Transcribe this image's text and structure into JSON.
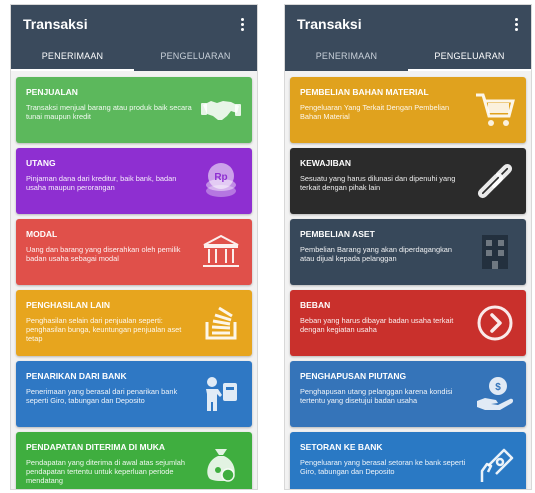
{
  "left_screen": {
    "title": "Transaksi",
    "tabs": [
      {
        "label": "PENERIMAAN",
        "active": true
      },
      {
        "label": "PENGELUARAN",
        "active": false
      }
    ],
    "cards": [
      {
        "title": "PENJUALAN",
        "desc": "Transaksi menjual barang atau produk baik secara tunai maupun kredit",
        "color": "#5cb85c",
        "icon": "handshake-icon"
      },
      {
        "title": "UTANG",
        "desc": "Pinjaman dana dari kreditur, baik bank, badan usaha maupun perorangan",
        "color": "#8e2fd1",
        "icon": "rp-coins-icon",
        "icon_text": "Rp"
      },
      {
        "title": "MODAL",
        "desc": "Uang dan barang yang diserahkan oleh pemilik badan usaha sebagai modal",
        "color": "#e0504a",
        "icon": "bank-icon"
      },
      {
        "title": "PENGHASILAN LAIN",
        "desc": "Penghasilan selain dari penjualan seperti: penghasilan bunga, keuntungan penjualan aset tetap",
        "color": "#e7a51e",
        "icon": "stack-icon"
      },
      {
        "title": "PENARIKAN DARI BANK",
        "desc": "Penerimaan yang berasal dari penarikan bank seperti Giro, tabungan dan Deposito",
        "color": "#2f78c4",
        "icon": "withdraw-icon"
      },
      {
        "title": "PENDAPATAN DITERIMA DI MUKA",
        "desc": "Pendapatan yang diterima di awal atas sejumlah pendapatan tertentu untuk keperluan periode mendatang",
        "color": "#3fae3f",
        "icon": "money-bag-icon"
      }
    ]
  },
  "right_screen": {
    "title": "Transaksi",
    "tabs": [
      {
        "label": "PENERIMAAN",
        "active": false
      },
      {
        "label": "PENGELUARAN",
        "active": true
      }
    ],
    "cards": [
      {
        "title": "PEMBELIAN BAHAN MATERIAL",
        "desc": "Pengeluaran Yang Terkait Dengan Pembelian Bahan Material",
        "color": "#e0a21e",
        "icon": "shopping-cart-icon"
      },
      {
        "title": "KEWAJIBAN",
        "desc": "Sesuatu yang harus dilunasi dan dipenuhi yang terkait dengan pihak lain",
        "color": "#2b2b2b",
        "icon": "link-icon"
      },
      {
        "title": "PEMBELIAN ASET",
        "desc": "Pembelian Barang yang akan diperdagangkan atau dijual kepada pelanggan",
        "color": "#37485a",
        "icon": "building-icon"
      },
      {
        "title": "BEBAN",
        "desc": "Beban yang harus dibayar badan usaha terkait dengan kegiatan usaha",
        "color": "#c9302c",
        "icon": "chevron-circle-icon"
      },
      {
        "title": "PENGHAPUSAN PIUTANG",
        "desc": "Penghapusan utang pelanggan karena kondisi tertentu yang disetujui badan usaha",
        "color": "#3574b9",
        "icon": "hand-coin-icon"
      },
      {
        "title": "SETORAN KE BANK",
        "desc": "Pengeluaran yang berasal setoran ke bank seperti Giro, tabungan dan Deposito",
        "color": "#2a79c4",
        "icon": "deposit-icon"
      }
    ]
  }
}
